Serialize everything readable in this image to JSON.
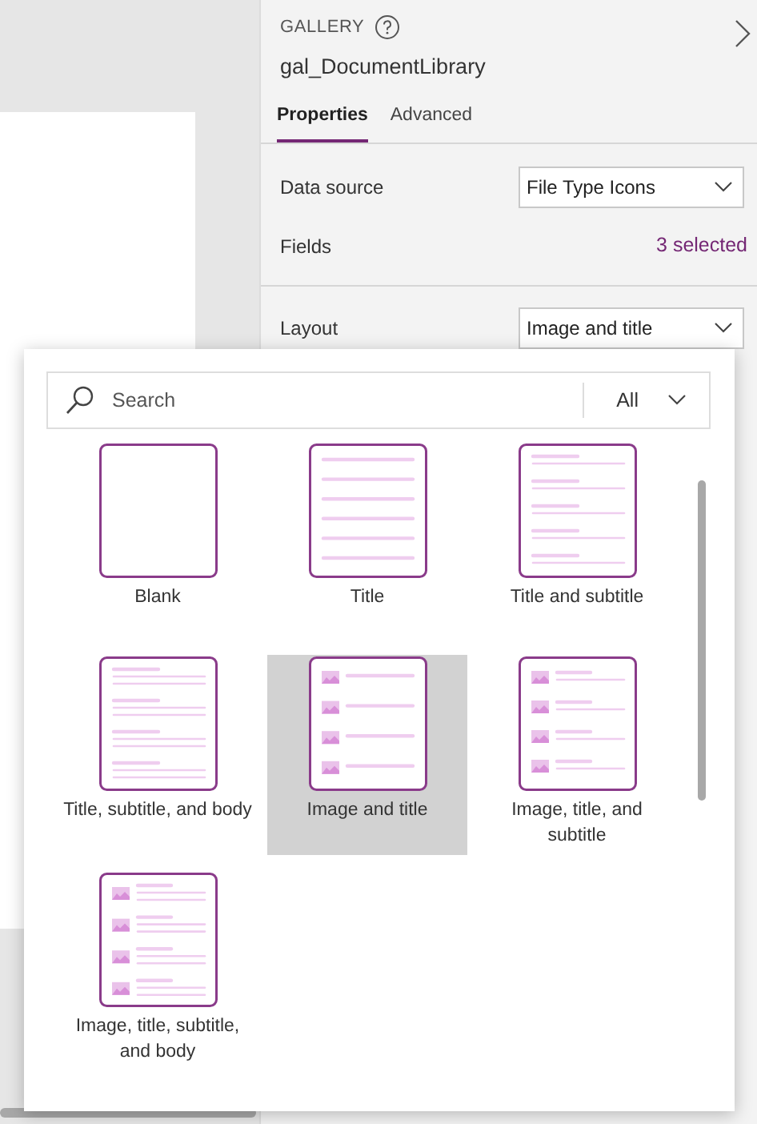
{
  "panel": {
    "type_label": "GALLERY",
    "name": "gal_DocumentLibrary",
    "tabs": [
      {
        "label": "Properties",
        "selected": true
      },
      {
        "label": "Advanced",
        "selected": false
      }
    ],
    "rows": [
      {
        "kind": "dropdown",
        "label": "Data source",
        "value": "File Type Icons"
      },
      {
        "kind": "link",
        "label": "Fields",
        "value": "3 selected"
      },
      {
        "kind": "dropdown",
        "label": "Layout",
        "value": "Image and title"
      }
    ]
  },
  "layout_picker": {
    "search": {
      "placeholder": "Search"
    },
    "filter": "All",
    "items": [
      {
        "kind": "blank",
        "label": "Blank",
        "selected": false
      },
      {
        "kind": "title",
        "label": "Title",
        "selected": false
      },
      {
        "kind": "title-subtitle",
        "label": "Title and subtitle",
        "selected": false
      },
      {
        "kind": "title-subtitle-body",
        "label": "Title, subtitle, and body",
        "selected": false
      },
      {
        "kind": "image-title",
        "label": "Image and title",
        "selected": true
      },
      {
        "kind": "image-title-subtitle",
        "label": "Image, title, and subtitle",
        "selected": false
      },
      {
        "kind": "image-title-subtitle-body",
        "label": "Image, title, subtitle, and body",
        "selected": false
      }
    ]
  }
}
